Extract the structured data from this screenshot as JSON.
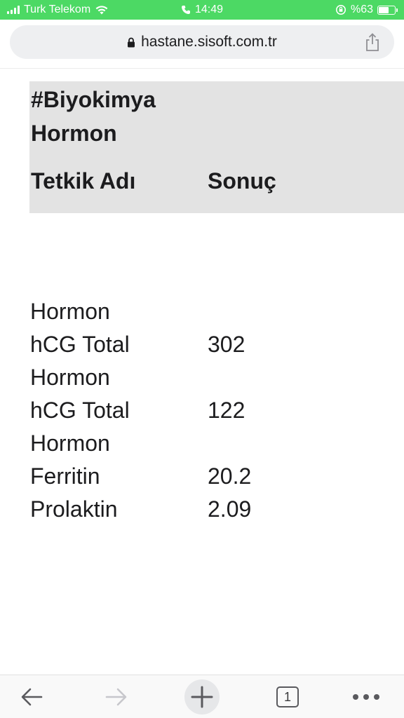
{
  "status_bar": {
    "carrier": "Turk Telekom",
    "time": "14:49",
    "battery_percent": "%63",
    "battery_level": 0.63,
    "icons": [
      "signal-icon",
      "wifi-icon",
      "phone-icon",
      "orientation-lock-icon",
      "battery-icon"
    ]
  },
  "browser": {
    "url": "hastane.sisoft.com.tr",
    "icons": [
      "lock-icon",
      "share-icon"
    ]
  },
  "report": {
    "section_title": "#Biyokimya Hormon",
    "columns": {
      "name": "Tetkik Adı",
      "result": "Sonuç"
    },
    "rows": [
      {
        "name": "Hormon",
        "value": ""
      },
      {
        "name": "hCG Total",
        "value": "302"
      },
      {
        "name": "Hormon",
        "value": ""
      },
      {
        "name": "hCG Total",
        "value": "122"
      },
      {
        "name": "Hormon",
        "value": ""
      },
      {
        "name": "Ferritin",
        "value": "20.2"
      },
      {
        "name": "Prolaktin",
        "value": "2.09"
      }
    ]
  },
  "toolbar": {
    "tab_count": "1",
    "icons": [
      "back-arrow-icon",
      "forward-arrow-icon",
      "new-tab-plus-icon",
      "tab-switcher-icon",
      "more-dots-icon"
    ]
  },
  "colors": {
    "status_bar_bg": "#4cd964",
    "header_block_bg": "#e3e3e3",
    "url_bar_bg": "#eeeff1",
    "text": "#1c1c1e"
  }
}
